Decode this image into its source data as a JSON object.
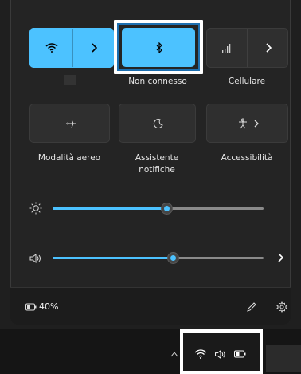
{
  "quick_settings": {
    "wifi": {
      "label": "",
      "icon": "wifi-icon",
      "expand_icon": "chevron-right-icon"
    },
    "bluetooth": {
      "label": "Non connesso",
      "icon": "bluetooth-icon"
    },
    "cellular": {
      "label": "Cellulare",
      "icon": "cellular-signal-icon",
      "expand_icon": "chevron-right-icon"
    },
    "airplane": {
      "label": "Modalità aereo",
      "icon": "airplane-icon"
    },
    "focus_assist": {
      "label_line1": "Assistente",
      "label_line2": "notifiche",
      "icon": "moon-icon"
    },
    "accessibility": {
      "label": "Accessibilità",
      "icon": "accessibility-icon",
      "expand_icon": "chevron-right-icon"
    }
  },
  "sliders": {
    "brightness": {
      "icon": "brightness-icon",
      "value_fraction": 0.54
    },
    "volume": {
      "icon": "speaker-icon",
      "value_fraction": 0.57,
      "expand_icon": "chevron-right-icon"
    }
  },
  "footer": {
    "battery_text": "40%",
    "battery_icon": "battery-icon",
    "edit_icon": "pencil-icon",
    "settings_icon": "gear-icon"
  },
  "taskbar": {
    "tray_icons": [
      "chevron-up-icon",
      "wifi-icon",
      "speaker-icon",
      "battery-icon"
    ]
  },
  "colors": {
    "accent": "#4cc2ff",
    "panel_bg": "#242424",
    "tile_bg": "#2f2f2f",
    "highlight_border": "#ffffff",
    "highlight_inner": "#1d6fb0"
  }
}
